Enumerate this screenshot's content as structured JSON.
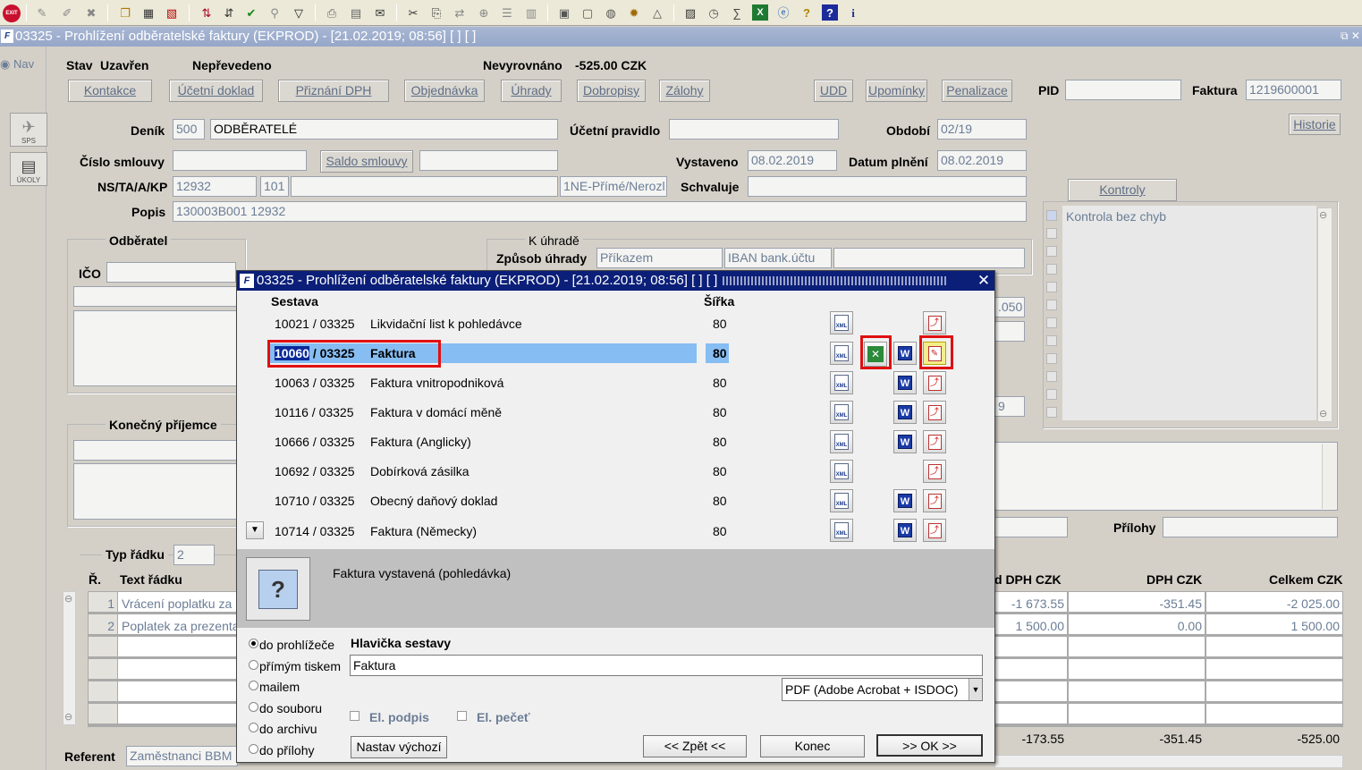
{
  "window": {
    "title": "03325 - Prohlížení odběratelské faktury (EKPROD) - [21.02.2019; 08:56]  [ ]  [ ]",
    "icon_letter": "F"
  },
  "toolbar": {
    "exit_label": "EXIT"
  },
  "nav": {
    "label": "Nav",
    "sps_label": "SPS",
    "okoly_label": "ÚKOLY"
  },
  "status": {
    "stav_label": "Stav",
    "stav_value": "Uzavřen",
    "prevod": "Nepřevedeno",
    "nevyrovnano_label": "Nevyrovnáno",
    "nevyrovnano_value": "-525.00 CZK"
  },
  "buttons": {
    "kontakce": "Kontakce",
    "ucetni_doklad": "Účetní doklad",
    "priznani_dph": "Přiznání DPH",
    "objednavka": "Objednávka",
    "uhrady": "Úhrady",
    "dobropisy": "Dobropisy",
    "zalohy": "Zálohy",
    "udd": "UDD",
    "upominky": "Upomínky",
    "penalizace": "Penalizace",
    "historie": "Historie",
    "saldo": "Saldo smlouvy",
    "kontroly": "Kontroly"
  },
  "form": {
    "pid_label": "PID",
    "pid_value": "",
    "faktura_label": "Faktura",
    "faktura_value": "1219600001",
    "denik_label": "Deník",
    "denik_code": "500",
    "denik_name": "ODBĚRATELÉ",
    "ucetni_pravidlo_label": "Účetní pravidlo",
    "ucetni_pravidlo_value": "",
    "obdobi_label": "Období",
    "obdobi_value": "02/19",
    "cislo_smlouvy_label": "Číslo smlouvy",
    "vystaveno_label": "Vystaveno",
    "vystaveno_value": "08.02.2019",
    "datum_plneni_label": "Datum plnění",
    "datum_plneni_value": "08.02.2019",
    "ns_label": "NS/TA/A/KP",
    "ns_value": "12932",
    "ta_value": "101",
    "kp_value": "1NE-Přímé/Nerozl.",
    "schvaluje_label": "Schvaluje",
    "popis_label": "Popis",
    "popis_value": "130003B001 12932",
    "odberatel_label": "Odběratel",
    "ico_label": "IČO",
    "k_uhrade_label": "K úhradě",
    "zpusob_uhrady_label": "Způsob úhrady",
    "zpusob_uhrady_value": "Příkazem",
    "iban_value": "IBAN bank.účtu",
    "konecny_prijemce_label": "Konečný příjemce",
    "kontrola_text": "Kontrola bez chyb",
    "prilohy_label": "Přílohy",
    "typ_radku_label": "Typ řádku",
    "typ_radku_value": "2",
    "referent_label": "Referent",
    "referent_value": "Zaměstnanci BBM",
    "partial_050": ".050",
    "partial_9": "9"
  },
  "lines": {
    "col_r": "Ř.",
    "col_text": "Text řádku",
    "col_zaklad": "d DPH CZK",
    "col_dph": "DPH CZK",
    "col_celkem": "Celkem CZK",
    "rows": [
      {
        "n": "1",
        "text": "Vrácení poplatku za",
        "zaklad": "-1 673.55",
        "dph": "-351.45",
        "celkem": "-2 025.00"
      },
      {
        "n": "2",
        "text": "Poplatek za prezenta",
        "zaklad": "1 500.00",
        "dph": "0.00",
        "celkem": "1 500.00"
      }
    ],
    "total_zaklad": "-173.55",
    "total_dph": "-351.45",
    "total_celkem": "-525.00"
  },
  "dialog": {
    "title": "03325 - Prohlížení odběratelské faktury (EKPROD) - [21.02.2019; 08:56]  [ ]  [ ]",
    "col_sestava": "Sestava",
    "col_sirka": "Šířka",
    "reports": [
      {
        "code": "10021",
        "sub": " / 03325",
        "name": "Likvidační list k pohledávce",
        "width": "80",
        "word": false
      },
      {
        "code": "10060",
        "sub": " / 03325",
        "name": "Faktura",
        "width": "80",
        "word": true
      },
      {
        "code": "10063",
        "sub": " / 03325",
        "name": "Faktura vnitropodniková",
        "width": "80",
        "word": true
      },
      {
        "code": "10116",
        "sub": " / 03325",
        "name": "Faktura v domácí měně",
        "width": "80",
        "word": true
      },
      {
        "code": "10666",
        "sub": " / 03325",
        "name": "Faktura (Anglicky)",
        "width": "80",
        "word": true
      },
      {
        "code": "10692",
        "sub": " / 03325",
        "name": "Dobírková zásilka",
        "width": "80",
        "word": false
      },
      {
        "code": "10710",
        "sub": " / 03325",
        "name": "Obecný daňový doklad",
        "width": "80",
        "word": true
      },
      {
        "code": "10714",
        "sub": " / 03325",
        "name": "Faktura (Německy)",
        "width": "80",
        "word": true
      }
    ],
    "description": "Faktura vystavená (pohledávka)",
    "output_options": [
      "do prohlížeče",
      "přímým tiskem",
      "mailem",
      "do souboru",
      "do archivu",
      "do přílohy"
    ],
    "hlavicka_label": "Hlavička sestavy",
    "hlavicka_value": "Faktura",
    "format_value": "PDF (Adobe Acrobat + ISDOC)",
    "el_podpis": "El. podpis",
    "el_pecet": "El. pečeť",
    "nastav_vychozi": "Nastav výchozí",
    "zpet": "<< Zpět <<",
    "konec": "Konec",
    "ok": ">> OK >>"
  },
  "colors": {
    "selection": "#86bdf2",
    "dialog_title": "#0b1f79",
    "highlight_box": "#e01010"
  }
}
